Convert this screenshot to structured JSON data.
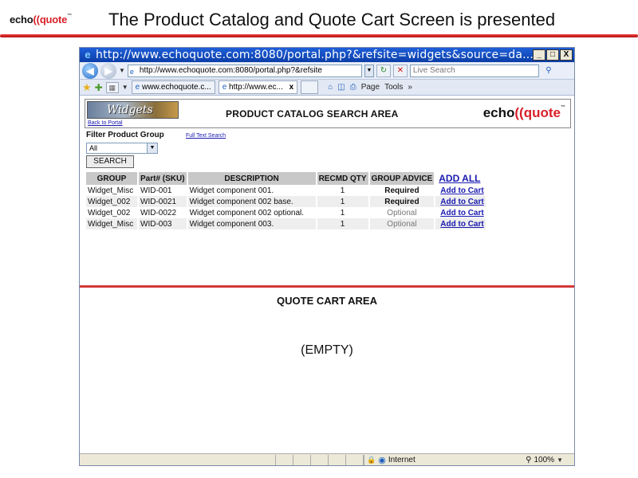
{
  "slide": {
    "logo": {
      "echo": "echo",
      "paren": "((",
      "quote": "quote",
      "tm": "™"
    },
    "title": "The Product Catalog and Quote Cart Screen is presented"
  },
  "browser": {
    "title": "http://www.echoquote.com:8080/portal.php?&refsite=widgets&source=da...",
    "window_buttons": [
      "_",
      "□",
      "X"
    ],
    "address": "http://www.echoquote.com:8080/portal.php?&refsite",
    "search_placeholder": "Live Search",
    "tabs": [
      {
        "label": "www.echoquote.c...",
        "active": false
      },
      {
        "label": "http://www.ec...",
        "active": true
      }
    ],
    "toolbar": {
      "page": "Page",
      "tools": "Tools"
    },
    "status": {
      "zone": "Internet",
      "zoom": "100%"
    }
  },
  "catalog": {
    "logo_text": "Widgets",
    "back_link": "Back to Portal",
    "title": "PRODUCT CATALOG SEARCH AREA",
    "brand": {
      "echo": "echo",
      "paren": "((",
      "quote": "quote",
      "tm": "™"
    },
    "filter_label": "Filter Product Group",
    "fulltext_link": "Full Text Search",
    "group_selected": "All",
    "search_button": "SEARCH",
    "columns": [
      "GROUP",
      "Part# (SKU)",
      "DESCRIPTION",
      "RECMD QTY",
      "GROUP ADVICE"
    ],
    "add_all": "ADD ALL",
    "rows": [
      {
        "group": "Widget_Misc",
        "sku": "WID-001",
        "description": "Widget component 001.",
        "qty": "1",
        "advice": "Required",
        "action": "Add to Cart"
      },
      {
        "group": "Widget_002",
        "sku": "WID-0021",
        "description": "Widget component 002 base.",
        "qty": "1",
        "advice": "Required",
        "action": "Add to Cart"
      },
      {
        "group": "Widget_002",
        "sku": "WID-0022",
        "description": "Widget component 002 optional.",
        "qty": "1",
        "advice": "Optional",
        "action": "Add to Cart"
      },
      {
        "group": "Widget_Misc",
        "sku": "WID-003",
        "description": "Widget component 003.",
        "qty": "1",
        "advice": "Optional",
        "action": "Add to Cart"
      }
    ]
  },
  "cart": {
    "title": "QUOTE CART AREA",
    "empty": "(EMPTY)"
  },
  "colors": {
    "accent_red": "#d8202a",
    "link_blue": "#1a1ab0",
    "titlebar_blue": "#0b3ea8"
  }
}
